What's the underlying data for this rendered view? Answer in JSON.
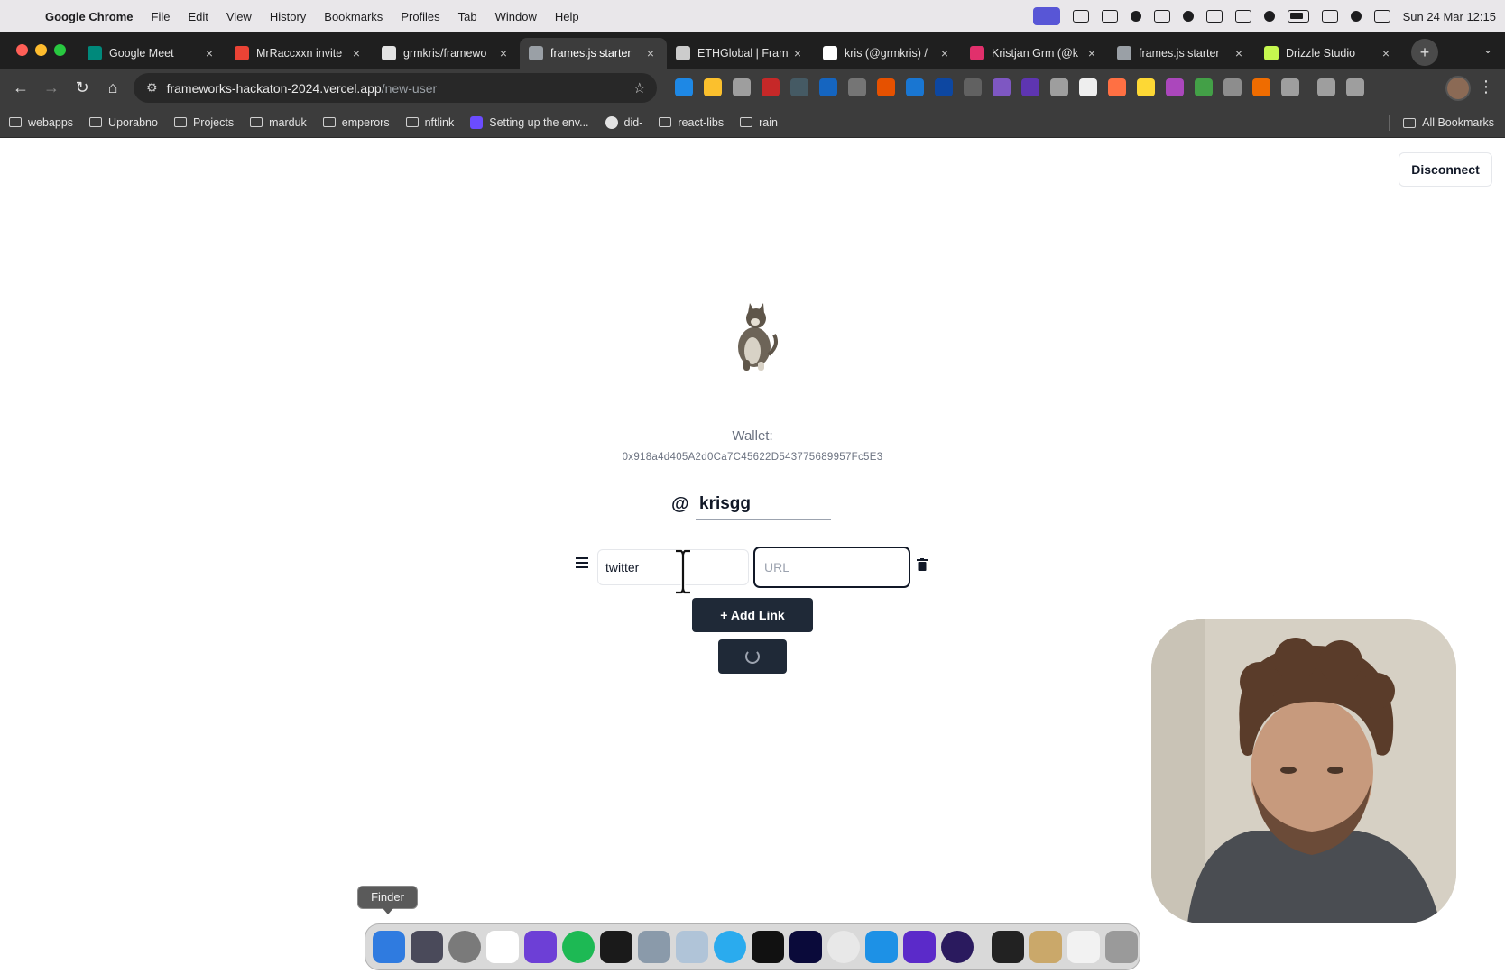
{
  "menubar": {
    "app_name": "Google Chrome",
    "menus": [
      "File",
      "Edit",
      "View",
      "History",
      "Bookmarks",
      "Profiles",
      "Tab",
      "Window",
      "Help"
    ],
    "datetime": "Sun 24 Mar  12:15"
  },
  "tabs": [
    {
      "label": "Google Meet",
      "icon": "google-meet-icon",
      "color": "#00897b",
      "active": false
    },
    {
      "label": "MrRaccxxn invite",
      "icon": "gmail-icon",
      "color": "#ea4335",
      "active": false
    },
    {
      "label": "grmkris/framewo",
      "icon": "github-icon",
      "color": "#e3e3e3",
      "active": false
    },
    {
      "label": "frames.js starter",
      "icon": "globe-icon",
      "color": "#9aa0a6",
      "active": true
    },
    {
      "label": "ETHGlobal | Fram",
      "icon": "ethglobal-icon",
      "color": "#cccccc",
      "active": false
    },
    {
      "label": "kris (@grmkris) /",
      "icon": "x-icon",
      "color": "#ffffff",
      "active": false
    },
    {
      "label": "Kristjan Grm (@k",
      "icon": "instagram-icon",
      "color": "#e1306c",
      "active": false
    },
    {
      "label": "frames.js starter",
      "icon": "globe-icon",
      "color": "#9aa0a6",
      "active": false
    },
    {
      "label": "Drizzle Studio",
      "icon": "drizzle-icon",
      "color": "#c5f74f",
      "active": false
    }
  ],
  "toolbar": {
    "url_host": "frameworks-hackaton-2024.vercel.app",
    "url_path": "/new-user"
  },
  "bookmarks": [
    {
      "label": "webapps",
      "icon": "folder-icon"
    },
    {
      "label": "Uporabno",
      "icon": "folder-icon"
    },
    {
      "label": "Projects",
      "icon": "folder-icon"
    },
    {
      "label": "marduk",
      "icon": "folder-icon"
    },
    {
      "label": "emperors",
      "icon": "folder-icon"
    },
    {
      "label": "nftlink",
      "icon": "folder-icon"
    },
    {
      "label": "Setting up the env...",
      "icon": "spark-icon"
    },
    {
      "label": "did-",
      "icon": "github-icon"
    },
    {
      "label": "react-libs",
      "icon": "folder-icon"
    },
    {
      "label": "rain",
      "icon": "folder-icon"
    }
  ],
  "all_bookmarks_label": "All Bookmarks",
  "page": {
    "disconnect_label": "Disconnect",
    "wallet_label": "Wallet:",
    "wallet_address": "0x918a4d405A2d0Ca7C45622D543775689957Fc5E3",
    "at_symbol": "@",
    "username": "krisgg",
    "link_row": {
      "platform_value": "twitter",
      "url_placeholder": "URL"
    },
    "add_link_label": "+ Add Link",
    "submit_state": "loading"
  },
  "dock": {
    "tooltip": "Finder"
  },
  "colors": {
    "primary_button": "#1f2937",
    "text_muted": "#6b7280",
    "chrome_dark": "#3c3c3c"
  }
}
